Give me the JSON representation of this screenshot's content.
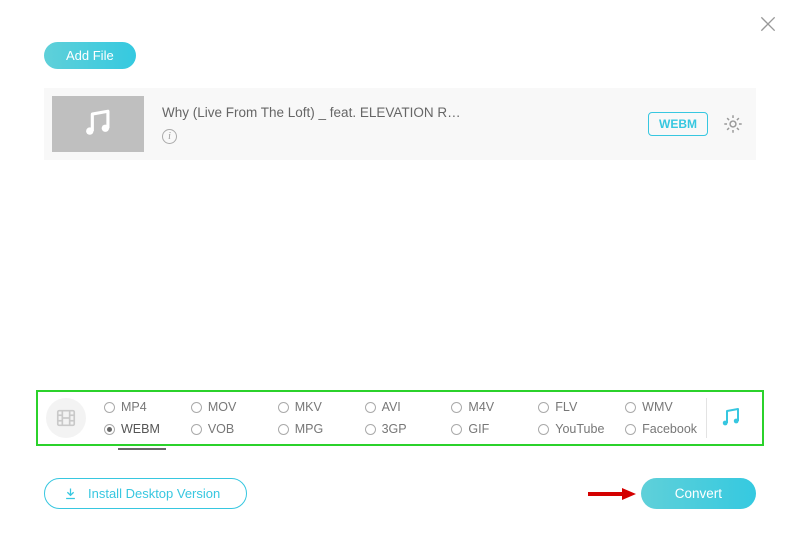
{
  "header": {
    "add_file_label": "Add File"
  },
  "file": {
    "title": "Why (Live From The Loft) _ feat. ELEVATION R…",
    "format_badge": "WEBM"
  },
  "formats": {
    "row1": [
      {
        "label": "MP4",
        "selected": false
      },
      {
        "label": "MOV",
        "selected": false
      },
      {
        "label": "MKV",
        "selected": false
      },
      {
        "label": "AVI",
        "selected": false
      },
      {
        "label": "M4V",
        "selected": false
      },
      {
        "label": "FLV",
        "selected": false
      },
      {
        "label": "WMV",
        "selected": false
      }
    ],
    "row2": [
      {
        "label": "WEBM",
        "selected": true
      },
      {
        "label": "VOB",
        "selected": false
      },
      {
        "label": "MPG",
        "selected": false
      },
      {
        "label": "3GP",
        "selected": false
      },
      {
        "label": "GIF",
        "selected": false
      },
      {
        "label": "YouTube",
        "selected": false
      },
      {
        "label": "Facebook",
        "selected": false
      }
    ]
  },
  "footer": {
    "install_label": "Install Desktop Version",
    "convert_label": "Convert"
  },
  "icons": {
    "close": "close-icon",
    "music_note": "music-note-icon",
    "info": "info-icon",
    "gear": "gear-icon",
    "filmstrip": "filmstrip-icon",
    "download": "download-icon"
  },
  "colors": {
    "accent": "#37c7e0",
    "highlight_border": "#2bd22b",
    "arrow": "#d40000"
  }
}
